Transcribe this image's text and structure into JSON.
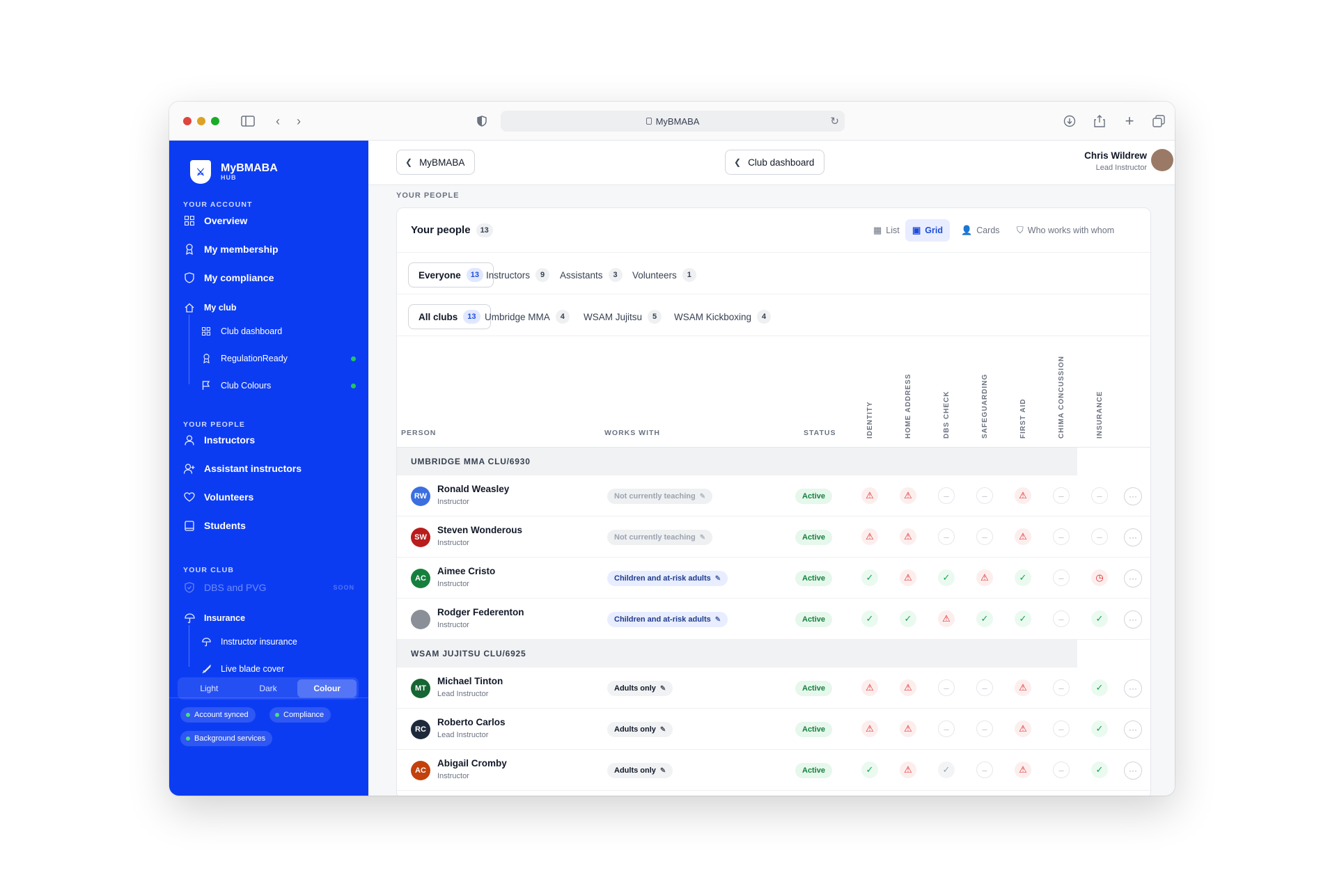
{
  "browser": {
    "url_title": "MyBMABA"
  },
  "brand": {
    "name": "MyBMABA",
    "sub": "HUB"
  },
  "sidebar": {
    "your_account_head": "YOUR ACCOUNT",
    "overview": "Overview",
    "my_membership": "My membership",
    "my_compliance": "My compliance",
    "my_club": "My club",
    "club_dashboard": "Club dashboard",
    "regulation_ready": "RegulationReady",
    "club_colours": "Club Colours",
    "your_people_head": "YOUR PEOPLE",
    "instructors": "Instructors",
    "assistant_instructors": "Assistant instructors",
    "volunteers": "Volunteers",
    "students": "Students",
    "your_club_head": "YOUR CLUB",
    "dbs_pvg": "DBS and PVG",
    "soon": "SOON",
    "insurance": "Insurance",
    "instructor_insurance": "Instructor insurance",
    "live_blade_cover": "Live blade cover",
    "pills": [
      "Account synced",
      "Compliance",
      "Background services"
    ],
    "themes": [
      "Light",
      "Dark",
      "Colour"
    ],
    "active_theme": "Colour"
  },
  "topbar": {
    "back_label": "MyBMABA",
    "dashboard_label": "Club dashboard",
    "user_name": "Chris Wildrew",
    "user_role": "Lead Instructor"
  },
  "breadcrumb": "YOUR PEOPLE",
  "people": {
    "title": "Your people",
    "count": "13",
    "views": [
      "List",
      "Grid",
      "Cards",
      "Who works with whom"
    ],
    "active_view": "Grid",
    "roles": [
      {
        "label": "Everyone",
        "count": "13"
      },
      {
        "label": "Instructors",
        "count": "9"
      },
      {
        "label": "Assistants",
        "count": "3"
      },
      {
        "label": "Volunteers",
        "count": "1"
      }
    ],
    "clubs": [
      {
        "label": "All clubs",
        "count": "13"
      },
      {
        "label": "Umbridge MMA",
        "count": "4"
      },
      {
        "label": "WSAM Jujitsu",
        "count": "5"
      },
      {
        "label": "WSAM Kickboxing",
        "count": "4"
      }
    ],
    "columns": {
      "person": "PERSON",
      "works_with": "WORKS WITH",
      "status": "STATUS",
      "checks": [
        "IDENTITY",
        "HOME ADDRESS",
        "DBS CHECK",
        "SAFEGUARDING",
        "FIRST AID",
        "CHIMA CONCUSSION",
        "INSURANCE"
      ]
    },
    "groups": [
      {
        "name": "UMBRIDGE MMA CLU/6930"
      },
      {
        "name": "WSAM JUJITSU CLU/6925"
      }
    ],
    "rows": [
      {
        "initials": "RW",
        "color": "#3b6fe0",
        "name": "Ronald Weasley",
        "role": "Instructor",
        "works": "Not currently teaching",
        "works_style": "grey",
        "status": "Active",
        "checks": [
          "warn",
          "warn",
          "na",
          "na",
          "warn",
          "na",
          "na"
        ]
      },
      {
        "initials": "SW",
        "color": "#b91c1c",
        "name": "Steven Wonderous",
        "role": "Instructor",
        "works": "Not currently teaching",
        "works_style": "grey",
        "status": "Active",
        "checks": [
          "warn",
          "warn",
          "na",
          "na",
          "warn",
          "na",
          "na"
        ]
      },
      {
        "initials": "AC",
        "color": "#15803d",
        "name": "Aimee Cristo",
        "role": "Instructor",
        "works": "Children and at-risk adults",
        "works_style": "blue",
        "status": "Active",
        "checks": [
          "ok",
          "warn",
          "ok",
          "warn",
          "ok",
          "na",
          "clock"
        ]
      },
      {
        "initials": "",
        "color": "#8a8f98",
        "name": "Rodger Federenton",
        "role": "Instructor",
        "works": "Children and at-risk adults",
        "works_style": "blue",
        "status": "Active",
        "checks": [
          "ok",
          "ok",
          "warn",
          "ok",
          "ok",
          "na",
          "ok"
        ]
      },
      {
        "initials": "MT",
        "color": "#166534",
        "name": "Michael Tinton",
        "role": "Lead Instructor",
        "works": "Adults only",
        "works_style": "plain",
        "status": "Active",
        "checks": [
          "warn",
          "warn",
          "na",
          "na",
          "warn",
          "na",
          "ok"
        ]
      },
      {
        "initials": "RC",
        "color": "#1e293b",
        "name": "Roberto Carlos",
        "role": "Lead Instructor",
        "works": "Adults only",
        "works_style": "plain",
        "status": "Active",
        "checks": [
          "warn",
          "warn",
          "na",
          "na",
          "warn",
          "na",
          "ok"
        ]
      },
      {
        "initials": "AC",
        "color": "#c2410c",
        "name": "Abigail Cromby",
        "role": "Instructor",
        "works": "Adults only",
        "works_style": "plain",
        "status": "Active",
        "checks": [
          "ok",
          "warn",
          "okdim",
          "na",
          "warn",
          "na",
          "ok"
        ]
      }
    ]
  },
  "colors": {
    "brand": "#0c3cf2",
    "active": "#15803d",
    "warn": "#dc2626"
  },
  "icons": {
    "check": "check-icon",
    "warn": "warning-icon",
    "na": "dash-icon",
    "clock": "clock-icon",
    "more": "more-icon"
  }
}
